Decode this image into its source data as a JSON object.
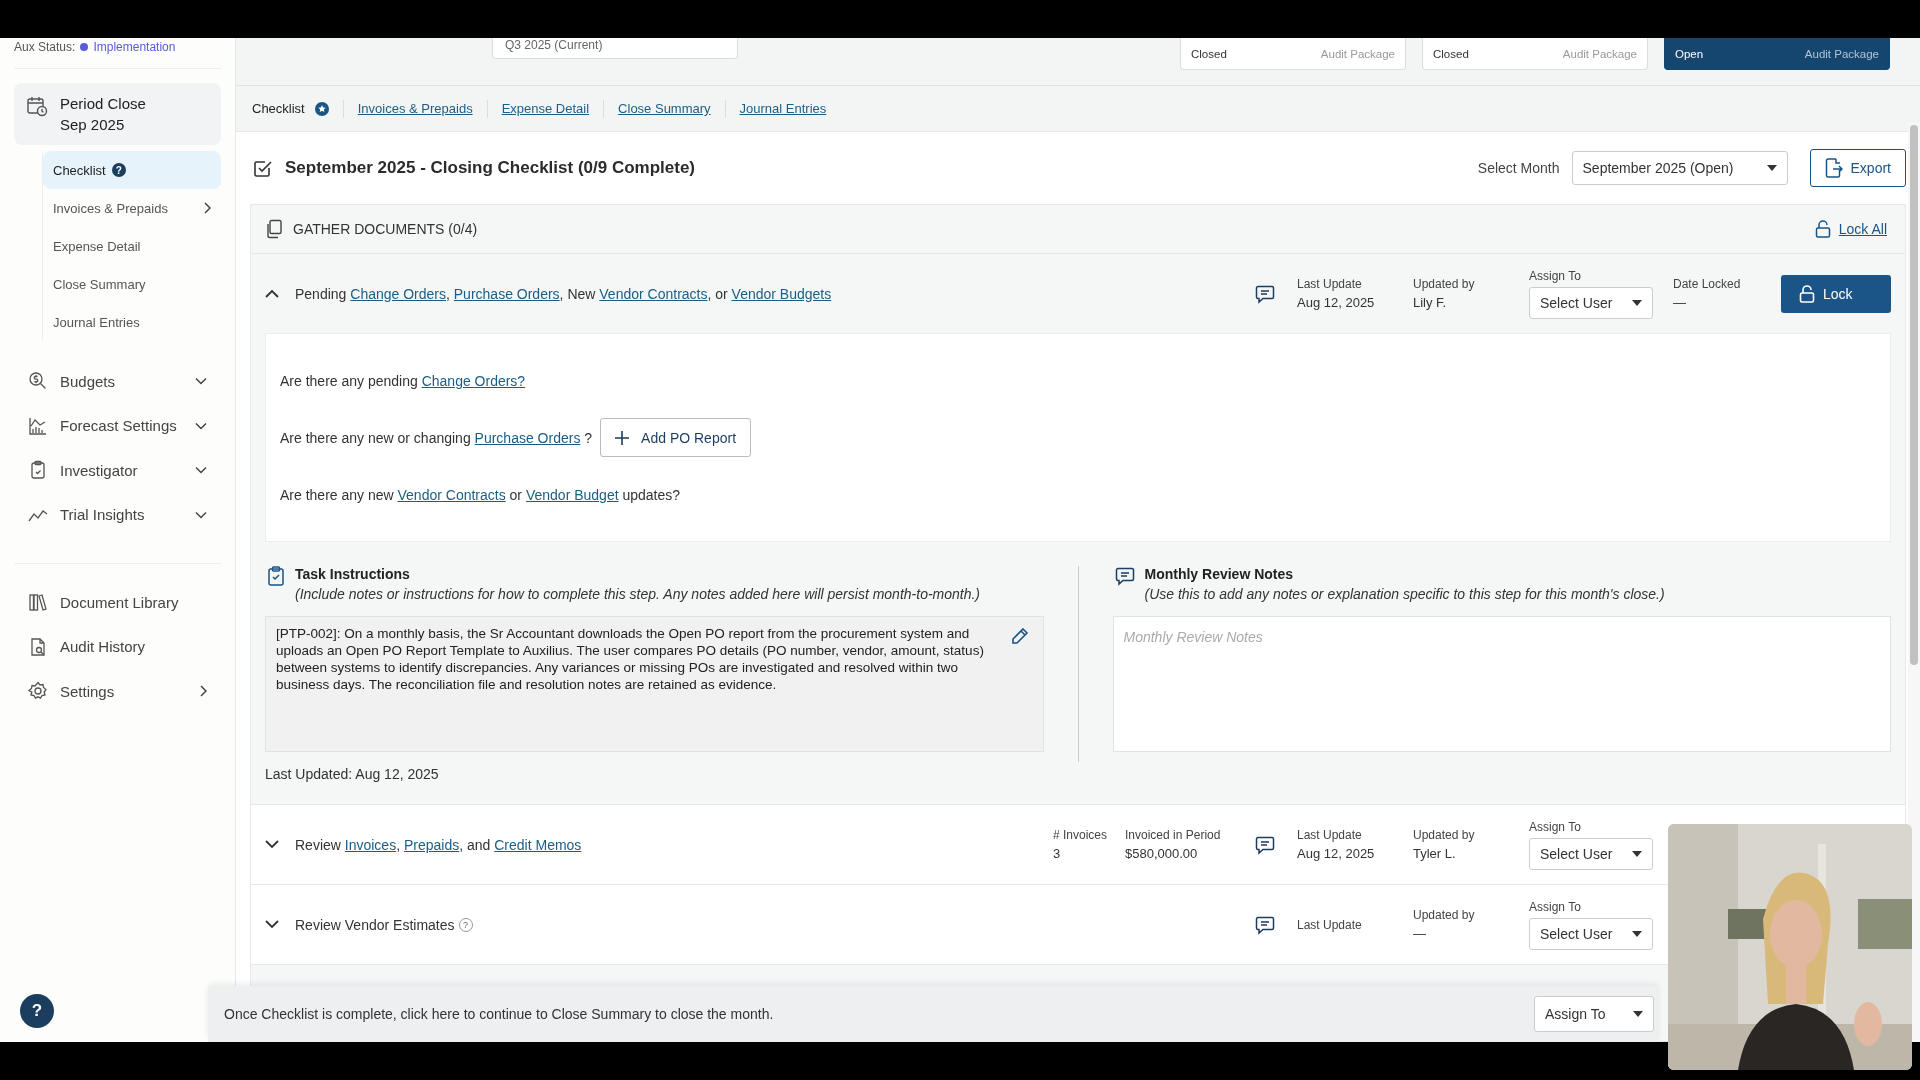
{
  "aux_status": {
    "label": "Aux Status:",
    "value": "Implementation"
  },
  "quarter_select": {
    "value": "Q3 2025 (Current)"
  },
  "periods": [
    {
      "status": "Closed",
      "action": "Audit Package",
      "selected": false
    },
    {
      "status": "Closed",
      "action": "Audit Package",
      "selected": false
    },
    {
      "status": "Open",
      "action": "Audit Package",
      "selected": true
    }
  ],
  "sidebar": {
    "period_card": {
      "title": "Period Close",
      "subtitle": "Sep 2025"
    },
    "sub_items": [
      {
        "label": "Checklist",
        "badge": "?",
        "kind": "link",
        "selected": true
      },
      {
        "label": "Invoices & Prepaids",
        "kind": "submenu",
        "selected": false
      },
      {
        "label": "Expense Detail",
        "kind": "link",
        "selected": false
      },
      {
        "label": "Close Summary",
        "kind": "link",
        "selected": false
      },
      {
        "label": "Journal Entries",
        "kind": "link",
        "selected": false
      }
    ],
    "groups": [
      [
        {
          "label": "Budgets",
          "kind": "collapsible"
        },
        {
          "label": "Forecast Settings",
          "kind": "collapsible"
        },
        {
          "label": "Investigator",
          "kind": "collapsible"
        },
        {
          "label": "Trial Insights",
          "kind": "collapsible"
        }
      ],
      [
        {
          "label": "Document Library",
          "kind": "link"
        },
        {
          "label": "Audit History",
          "kind": "link"
        },
        {
          "label": "Settings",
          "kind": "submenu"
        }
      ]
    ],
    "help": "?"
  },
  "tabs": [
    {
      "label": "Checklist",
      "selected": true
    },
    {
      "label": "Invoices & Prepaids",
      "selected": false
    },
    {
      "label": "Expense Detail",
      "selected": false
    },
    {
      "label": "Close Summary",
      "selected": false
    },
    {
      "label": "Journal Entries",
      "selected": false
    }
  ],
  "page_title": "September 2025 - Closing Checklist (0/9 Complete)",
  "month_select": {
    "label": "Select Month",
    "value": "September 2025 (Open)"
  },
  "export_button": "Export",
  "section": {
    "title": "GATHER DOCUMENTS (0/4)",
    "lock_all": "Lock All"
  },
  "rows": [
    {
      "expanded": true,
      "title": [
        {
          "kind": "text",
          "text": "Pending "
        },
        {
          "kind": "link",
          "text": "Change Orders"
        },
        {
          "kind": "text",
          "text": ", "
        },
        {
          "kind": "link",
          "text": "Purchase Orders"
        },
        {
          "kind": "text",
          "text": ", New "
        },
        {
          "kind": "link",
          "text": "Vendor Contracts"
        },
        {
          "kind": "text",
          "text": ", or "
        },
        {
          "kind": "link",
          "text": "Vendor Budgets"
        }
      ],
      "metrics": [],
      "last_update_label": "Last Update",
      "last_update": "Aug 12, 2025",
      "updated_by_label": "Updated by",
      "updated_by": "Lily F.",
      "assign_label": "Assign To",
      "assign_value": "Select User",
      "date_locked_label": "Date Locked",
      "date_locked": "—",
      "lock_button": "Lock",
      "questions": [
        {
          "parts": [
            {
              "kind": "text",
              "text": "Are there any pending "
            },
            {
              "kind": "link",
              "text": "Change Orders?"
            }
          ]
        },
        {
          "parts": [
            {
              "kind": "text",
              "text": "Are there any new or changing "
            },
            {
              "kind": "link",
              "text": "Purchase Orders"
            },
            {
              "kind": "text",
              "text": " ?"
            }
          ],
          "button": "Add PO Report"
        },
        {
          "parts": [
            {
              "kind": "text",
              "text": "Are there any new "
            },
            {
              "kind": "link",
              "text": "Vendor Contracts"
            },
            {
              "kind": "text",
              "text": " or "
            },
            {
              "kind": "link",
              "text": "Vendor Budget"
            },
            {
              "kind": "text",
              "text": " updates?"
            }
          ]
        }
      ],
      "instructions": {
        "title": "Task Instructions",
        "hint": "(Include notes or instructions for how to complete this step. Any notes added here will persist month-to-month.)",
        "text": "[PTP-002]: On a monthly basis, the Sr Accountant downloads the Open PO report from the procurement system and uploads an Open PO Report Template to Auxilius. The user compares PO details (PO number, vendor, amount, status) between systems to identify discrepancies. Any variances or missing POs are investigated and resolved within two business days. The reconciliation file and resolution notes are retained as evidence.",
        "last_updated": "Last Updated: Aug 12, 2025"
      },
      "review_notes": {
        "title": "Monthly Review Notes",
        "hint": "(Use this to add any notes or explanation specific to this step for this month's close.)",
        "placeholder": "Monthly Review Notes"
      }
    },
    {
      "expanded": false,
      "title": [
        {
          "kind": "text",
          "text": "Review "
        },
        {
          "kind": "link",
          "text": "Invoices"
        },
        {
          "kind": "text",
          "text": ", "
        },
        {
          "kind": "link",
          "text": "Prepaids"
        },
        {
          "kind": "text",
          "text": ", and "
        },
        {
          "kind": "link",
          "text": "Credit Memos"
        }
      ],
      "metrics": [
        {
          "label": "# Invoices",
          "value": "3"
        },
        {
          "label": "Invoiced in Period",
          "value": "$580,000.00"
        }
      ],
      "last_update_label": "Last Update",
      "last_update": "Aug 12, 2025",
      "updated_by_label": "Updated by",
      "updated_by": "Tyler L.",
      "assign_label": "Assign To",
      "assign_value": "Select User"
    },
    {
      "expanded": false,
      "title": [
        {
          "kind": "text",
          "text": "Review Vendor Estimates"
        }
      ],
      "badge": "?",
      "metrics": [],
      "last_update_label": "Last Update",
      "updated_by_label": "Updated by",
      "updated_by": "—",
      "assign_label": "Assign To",
      "assign_value": "Select User"
    }
  ],
  "footer": {
    "text": "Once Checklist is complete, click here to continue to Close Summary to close the month.",
    "assign_value": "Assign To"
  }
}
